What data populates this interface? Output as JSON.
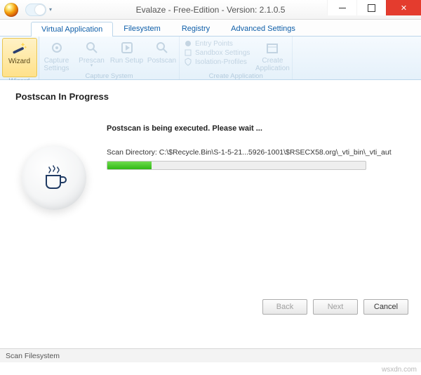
{
  "window": {
    "title": "Evalaze - Free-Edition - Version: 2.1.0.5"
  },
  "tabs": {
    "virtual_app": "Virtual Application",
    "filesystem": "Filesystem",
    "registry": "Registry",
    "advanced": "Advanced Settings"
  },
  "ribbon": {
    "wizard": {
      "label": "Wizard",
      "group": "Wizard"
    },
    "capture_settings": "Capture Settings",
    "prescan": "Prescan",
    "run_setup": "Run Setup",
    "postscan": "Postscan",
    "group_capture": "Capture System",
    "entry_points": "Entry Points",
    "sandbox_settings": "Sandbox Settings",
    "isolation_profiles": "Isolation-Profiles",
    "create_app": "Create Application",
    "group_create": "Create Application"
  },
  "page": {
    "heading": "Postscan In Progress",
    "status": "Postscan is being executed. Please wait ...",
    "scan_label": "Scan Directory: ",
    "scan_path": "C:\\$Recycle.Bin\\S-1-5-21...5926-1001\\$RSECX58.org\\_vti_bin\\_vti_aut",
    "progress_percent": 17
  },
  "buttons": {
    "back": "Back",
    "next": "Next",
    "cancel": "Cancel"
  },
  "status": "Scan Filesystem",
  "watermark": "wsxdn.com"
}
